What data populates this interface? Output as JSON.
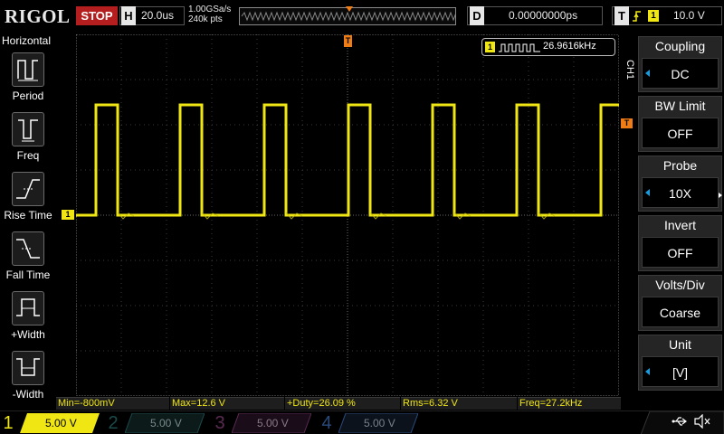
{
  "brand": "RIGOL",
  "top": {
    "run_state": "STOP",
    "h_key": "H",
    "timebase": "20.0us",
    "sample_rate": "1.00GSa/s",
    "mem_depth": "240k pts",
    "d_key": "D",
    "delay": "0.00000000ps",
    "t_key": "T",
    "trig_source": "1",
    "trig_level": "10.0 V"
  },
  "left": {
    "title": "Horizontal",
    "items": [
      {
        "label": "Period"
      },
      {
        "label": "Freq"
      },
      {
        "label": "Rise Time"
      },
      {
        "label": "Fall Time"
      },
      {
        "label": "+Width"
      },
      {
        "label": "-Width"
      }
    ]
  },
  "markers": {
    "trigger_pos": "T",
    "channel": "1",
    "trig_level": "T"
  },
  "freq_counter": {
    "channel": "1",
    "value": "26.9616kHz"
  },
  "measurements": [
    "Min=-800mV",
    "Max=12.6 V",
    "+Duty=26.09 %",
    "Rms=6.32 V",
    "Freq=27.2kHz"
  ],
  "right": {
    "channel_label": "CH1",
    "items": [
      {
        "title": "Coupling",
        "value": "DC"
      },
      {
        "title": "BW Limit",
        "value": "OFF"
      },
      {
        "title": "Probe",
        "value": "10X"
      },
      {
        "title": "Invert",
        "value": "OFF"
      },
      {
        "title": "Volts/Div",
        "value": "Coarse"
      },
      {
        "title": "Unit",
        "value": "[V]"
      }
    ]
  },
  "channels": [
    {
      "num": "1",
      "scale": "5.00 V"
    },
    {
      "num": "2",
      "scale": "5.00 V"
    },
    {
      "num": "3",
      "scale": "5.00 V"
    },
    {
      "num": "4",
      "scale": "5.00 V"
    }
  ],
  "colors": {
    "ch1": "#f0e614",
    "ch2": "#1fb4b4",
    "ch3": "#c03ca0",
    "ch4": "#2a7ad0",
    "trigger": "#f07c16",
    "stop": "#b51e1e",
    "accent": "#1c9bdc"
  }
}
